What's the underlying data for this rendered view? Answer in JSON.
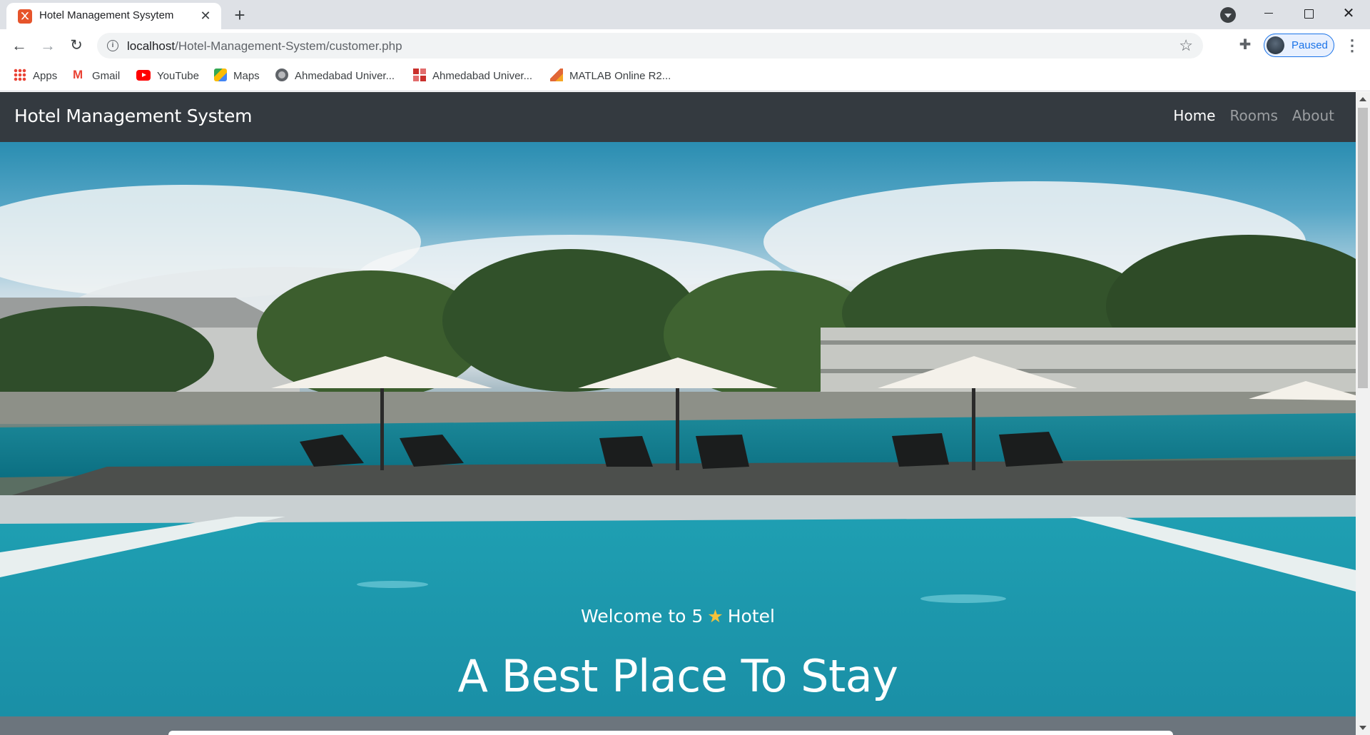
{
  "browser": {
    "tab_title": "Hotel Management Sysytem",
    "tab_close": "✕",
    "new_tab": "+",
    "url_host": "localhost",
    "url_path": "/Hotel-Management-System/customer.php",
    "profile_label": "Paused",
    "bookmarks": [
      {
        "label": "Apps",
        "icon": "apps-icon"
      },
      {
        "label": "Gmail",
        "icon": "gmail-icon"
      },
      {
        "label": "YouTube",
        "icon": "youtube-icon"
      },
      {
        "label": "Maps",
        "icon": "maps-icon"
      },
      {
        "label": "Ahmedabad Univer...",
        "icon": "globe-icon"
      },
      {
        "label": "Ahmedabad Univer...",
        "icon": "grid-icon"
      },
      {
        "label": "MATLAB Online R2...",
        "icon": "matlab-icon"
      }
    ]
  },
  "site": {
    "brand": "Hotel Management System",
    "nav": [
      {
        "label": "Home",
        "active": true
      },
      {
        "label": "Rooms",
        "active": false
      },
      {
        "label": "About",
        "active": false
      }
    ],
    "hero": {
      "welcome_prefix": "Welcome to 5",
      "star": "★",
      "welcome_suffix": "Hotel",
      "title": "A Best Place To Stay"
    }
  },
  "colors": {
    "navbar": "#343a40",
    "nav_active": "#ffffff",
    "nav_inactive": "#8e9296",
    "star": "#f6c23a",
    "below_hero": "#6c757d"
  }
}
